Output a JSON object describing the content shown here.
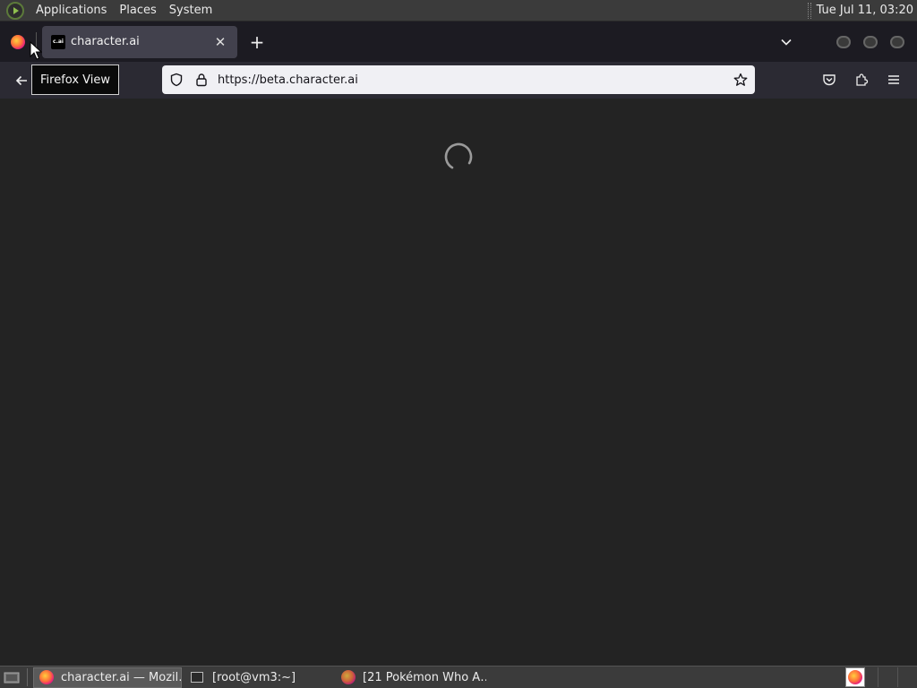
{
  "top_panel": {
    "menus": [
      "Applications",
      "Places",
      "System"
    ],
    "clock": "Tue Jul 11, 03:20"
  },
  "browser": {
    "tooltip": "Firefox View",
    "tab": {
      "favicon_text": "c.ai",
      "title": "character.ai"
    },
    "url": "https://beta.character.ai",
    "icons": {
      "firefox_view": "firefox-logo-icon",
      "new_tab": "plus-icon",
      "list_tabs": "chevron-down-icon",
      "back": "arrow-left-icon",
      "shield": "shield-icon",
      "lock": "lock-icon",
      "bookmark": "star-icon",
      "pocket": "pocket-icon",
      "extensions": "puzzle-icon",
      "menu": "hamburger-menu-icon"
    },
    "page_state": "loading"
  },
  "taskbar": {
    "tasks": [
      {
        "label": "character.ai — Mozil…",
        "icon": "firefox-icon",
        "active": true
      },
      {
        "label": "[root@vm3:~]",
        "icon": "terminal-icon",
        "active": false
      },
      {
        "label": "[21 Pokémon Who A…",
        "icon": "firefox-icon",
        "active": false
      }
    ]
  },
  "colors": {
    "panel": "#3b3b3b",
    "tabstrip": "#1c1b22",
    "tab_active": "#42414d",
    "navbar": "#2b2a33",
    "urlbar": "#f0f0f4",
    "content": "#232323"
  }
}
